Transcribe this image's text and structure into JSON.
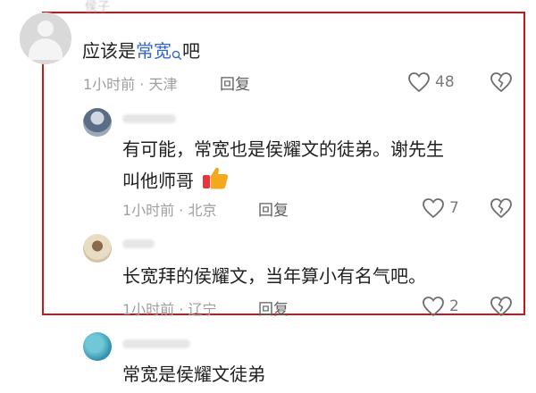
{
  "comments": [
    {
      "user": "侯子",
      "text_before": "应该是",
      "highlight": "常宽",
      "text_after": "吧",
      "time": "1小时前",
      "location": "天津",
      "reply_label": "回复",
      "likes": "48"
    }
  ],
  "replies": [
    {
      "line1": "有可能，常宽也是侯耀文的徒弟。谢先生",
      "line2": "叫他师哥",
      "emoji": "thumbs-up-icon",
      "time": "1小时前",
      "location": "北京",
      "reply_label": "回复",
      "likes": "7"
    },
    {
      "line1": "长宽拜的侯耀文，当年算小有名气吧。",
      "time": "1小时前",
      "location": "辽宁",
      "reply_label": "回复",
      "likes": "2"
    },
    {
      "line1": "常宽是侯耀文徒弟"
    }
  ],
  "colors": {
    "highlight_box": "#c8171c",
    "link": "#3366cc",
    "meta_text": "#9e9e9e"
  }
}
